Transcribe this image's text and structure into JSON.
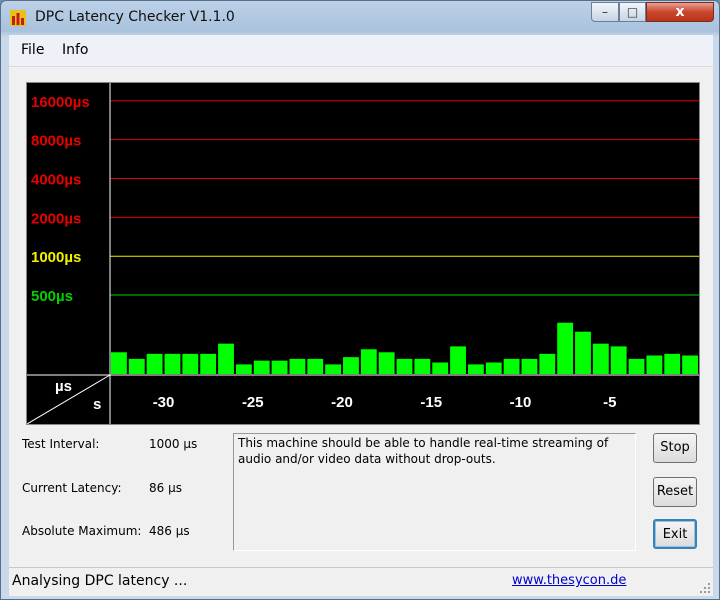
{
  "window": {
    "title": "DPC Latency Checker V1.1.0",
    "minimize_label": "–",
    "maximize_label": "□",
    "close_label": "x"
  },
  "menu": {
    "items": [
      "File",
      "Info"
    ]
  },
  "graph": {
    "unit_y": "µs",
    "unit_x": "s",
    "y_levels": [
      {
        "label": "16000µs",
        "value": 16000,
        "color": "#e60000"
      },
      {
        "label": "8000µs",
        "value": 8000,
        "color": "#e60000"
      },
      {
        "label": "4000µs",
        "value": 4000,
        "color": "#e60000"
      },
      {
        "label": "2000µs",
        "value": 2000,
        "color": "#e60000"
      },
      {
        "label": "1000µs",
        "value": 1000,
        "color": "#f0f000"
      },
      {
        "label": "500µs",
        "value": 500,
        "color": "#00d000"
      }
    ],
    "x_ticks": [
      {
        "label": "-30",
        "value": -30
      },
      {
        "label": "-25",
        "value": -25
      },
      {
        "label": "-20",
        "value": -20
      },
      {
        "label": "-15",
        "value": -15
      },
      {
        "label": "-10",
        "value": -10
      },
      {
        "label": "-5",
        "value": -5
      }
    ],
    "bar_color": "#00ff00"
  },
  "chart_data": {
    "type": "bar",
    "xlabel": "s",
    "ylabel": "µs",
    "x": [
      -32.5,
      -31.5,
      -30.5,
      -29.5,
      -28.5,
      -27.5,
      -26.5,
      -25.5,
      -24.5,
      -23.5,
      -22.5,
      -21.5,
      -20.5,
      -19.5,
      -18.5,
      -17.5,
      -16.5,
      -15.5,
      -14.5,
      -13.5,
      -12.5,
      -11.5,
      -10.5,
      -9.5,
      -8.5,
      -7.5,
      -6.5,
      -5.5,
      -4.5,
      -3.5,
      -2.5,
      -1.5,
      -0.5
    ],
    "values": [
      180,
      160,
      175,
      175,
      175,
      175,
      210,
      145,
      155,
      155,
      160,
      160,
      145,
      165,
      190,
      180,
      160,
      160,
      150,
      200,
      145,
      150,
      160,
      160,
      175,
      305,
      260,
      210,
      200,
      160,
      170,
      175,
      170
    ],
    "ylim": [
      120,
      22000
    ],
    "y_scale": "log",
    "xlim": [
      -33,
      0
    ]
  },
  "stats": {
    "test_interval_label": "Test Interval:",
    "test_interval_value": "1000 µs",
    "current_latency_label": "Current Latency:",
    "current_latency_value": "86 µs",
    "absolute_max_label": "Absolute Maximum:",
    "absolute_max_value": "486 µs"
  },
  "message": "This machine should be able to handle real-time streaming of audio and/or video data without drop-outs.",
  "buttons": {
    "stop": "Stop",
    "reset": "Reset",
    "exit": "Exit"
  },
  "status": {
    "text": "Analysing DPC latency ...",
    "link": "www.thesycon.de"
  }
}
